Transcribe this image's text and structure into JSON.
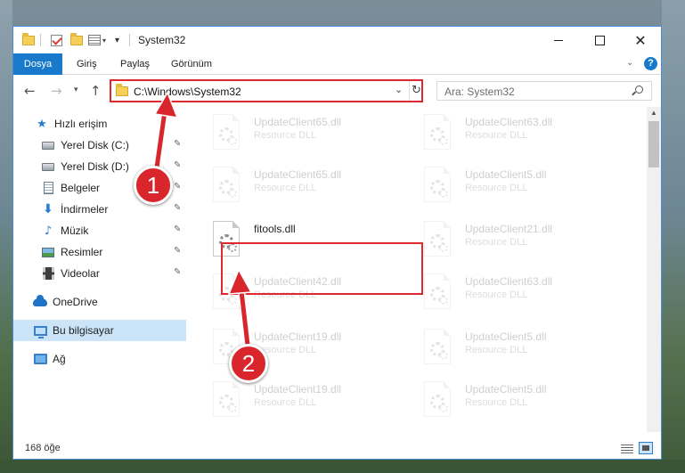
{
  "window": {
    "title": "System32"
  },
  "ribbon": {
    "tabs": [
      "Dosya",
      "Giriş",
      "Paylaş",
      "Görünüm"
    ]
  },
  "address": {
    "path": "C:\\Windows\\System32",
    "search_placeholder": "Ara: System32"
  },
  "sidebar": {
    "items": [
      {
        "label": "Hızlı erişim",
        "icon": "star-icon"
      },
      {
        "label": "Yerel Disk (C:)",
        "icon": "disk-icon",
        "pinned": true
      },
      {
        "label": "Yerel Disk (D:)",
        "icon": "disk-icon",
        "pinned": true
      },
      {
        "label": "Belgeler",
        "icon": "documents-icon",
        "pinned": true
      },
      {
        "label": "İndirmeler",
        "icon": "downloads-icon",
        "pinned": true
      },
      {
        "label": "Müzik",
        "icon": "music-icon",
        "pinned": true
      },
      {
        "label": "Resimler",
        "icon": "pictures-icon",
        "pinned": true
      },
      {
        "label": "Videolar",
        "icon": "videos-icon",
        "pinned": true
      },
      {
        "label": "OneDrive",
        "icon": "cloud-icon"
      },
      {
        "label": "Bu bilgisayar",
        "icon": "computer-icon",
        "selected": true
      },
      {
        "label": "Ağ",
        "icon": "network-icon"
      }
    ]
  },
  "files": {
    "left": [
      {
        "name": "UpdateClient65.dll",
        "type": "Resource DLL"
      },
      {
        "name": "UpdateClient65.dll",
        "type": "Resource DLL"
      },
      {
        "name": "fitools.dll",
        "type": ""
      },
      {
        "name": "UpdateClient42.dll",
        "type": "Resource DLL"
      },
      {
        "name": "UpdateClient19.dll",
        "type": "Resource DLL"
      },
      {
        "name": "UpdateClient19.dll",
        "type": "Resource DLL"
      }
    ],
    "right": [
      {
        "name": "UpdateClient63.dll",
        "type": "Resource DLL"
      },
      {
        "name": "UpdateClient5.dll",
        "type": "Resource DLL"
      },
      {
        "name": "UpdateClient21.dll",
        "type": "Resource DLL"
      },
      {
        "name": "UpdateClient63.dll",
        "type": "Resource DLL"
      },
      {
        "name": "UpdateClient5.dll",
        "type": "Resource DLL"
      },
      {
        "name": "UpdateClient5.dll",
        "type": "Resource DLL"
      }
    ]
  },
  "status": {
    "count": "168 öğe"
  },
  "annotations": {
    "badge1": "1",
    "badge2": "2",
    "color": "#d8262c"
  }
}
